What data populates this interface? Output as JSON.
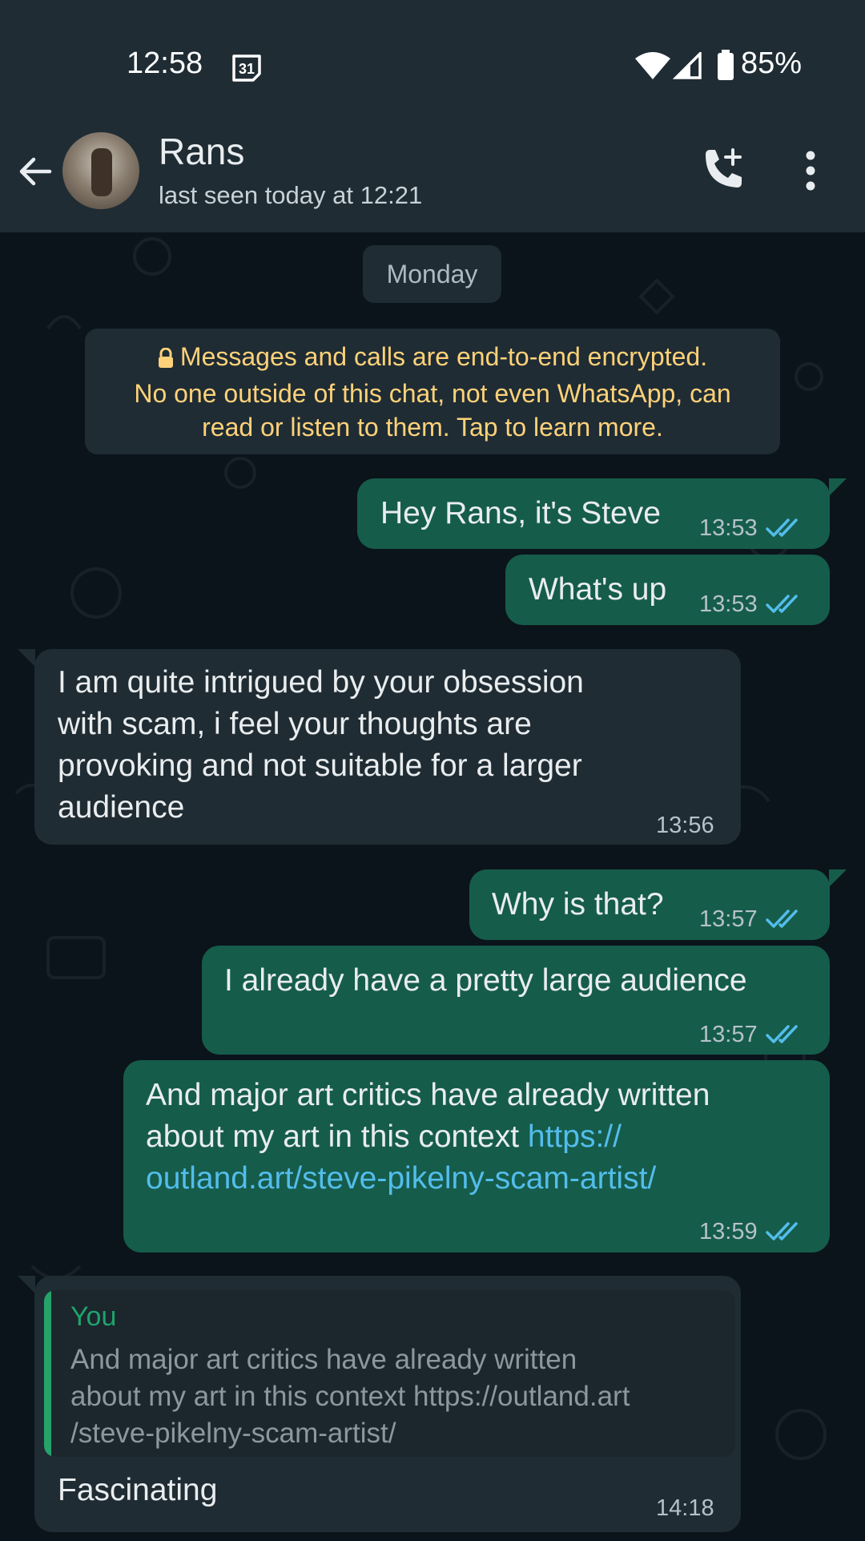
{
  "status_bar": {
    "time": "12:58",
    "calendar_day": "31",
    "battery": "85%"
  },
  "header": {
    "contact_name": "Rans",
    "last_seen": "last seen today at 12:21"
  },
  "date_label": "Monday",
  "encryption_notice": {
    "line1": "Messages and calls are end-to-end encrypted.",
    "line2": "No one outside of this chat, not even WhatsApp, can",
    "line3": "read or listen to them. Tap to learn more."
  },
  "messages": [
    {
      "direction": "out",
      "text": "Hey Rans, it's Steve",
      "time": "13:53",
      "status": "read"
    },
    {
      "direction": "out",
      "text": "What's up",
      "time": "13:53",
      "status": "read"
    },
    {
      "direction": "in",
      "lines": [
        "I am quite intrigued by your obsession",
        "with scam, i feel your thoughts are",
        "provoking and not suitable for a larger",
        "audience"
      ],
      "time": "13:56"
    },
    {
      "direction": "out",
      "text": "Why is that?",
      "time": "13:57",
      "status": "read"
    },
    {
      "direction": "out",
      "text": "I already have a pretty large audience",
      "time": "13:57",
      "status": "read"
    },
    {
      "direction": "out",
      "line1": "And major art critics have already written",
      "line2_text": "about my art in this context ",
      "line2_link": "https://",
      "line3_link": "outland.art/steve-pikelny-scam-artist/",
      "time": "13:59",
      "status": "read"
    },
    {
      "direction": "in",
      "quote_author": "You",
      "quote_text": "And major art critics have already written\nabout my art in this context https://outland.art\n/steve-pikelny-scam-artist/",
      "text": "Fascinating",
      "time": "14:18"
    }
  ],
  "colors": {
    "outgoing_bubble": "#165c4b",
    "incoming_bubble": "#202c33",
    "read_ticks": "#53bdeb",
    "encryption_text": "#ffd279",
    "link": "#53bdeb"
  }
}
